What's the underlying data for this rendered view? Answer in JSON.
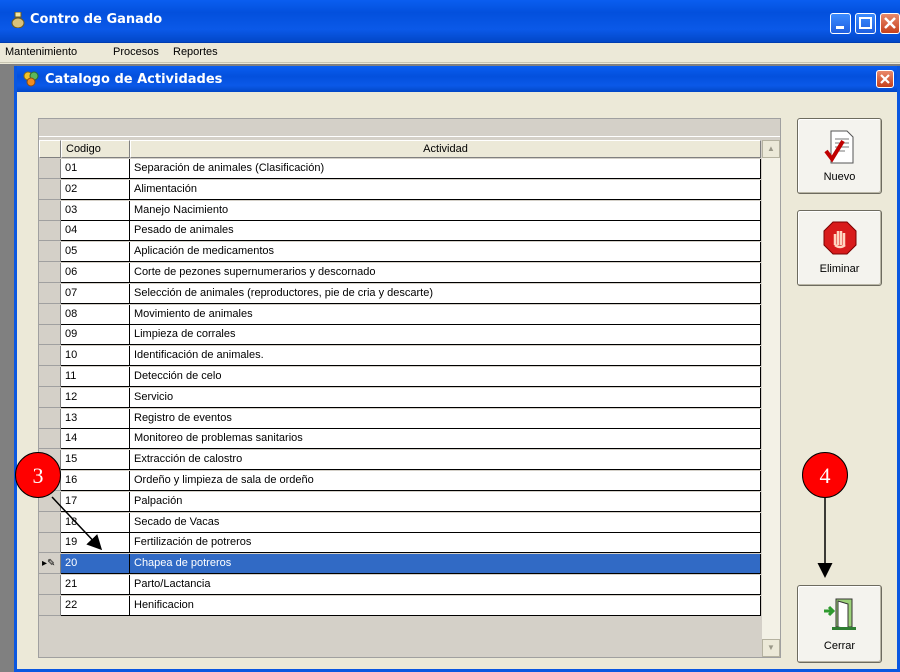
{
  "window": {
    "title": "Contro de Ganado"
  },
  "menu": [
    "Mantenimiento",
    "Procesos",
    "Reportes"
  ],
  "child_window": {
    "title": "Catalogo de Actividades"
  },
  "grid": {
    "headers": {
      "codigo": "Codigo",
      "actividad": "Actividad"
    },
    "rows": [
      {
        "codigo": "01",
        "actividad": "Separación de animales (Clasificación)"
      },
      {
        "codigo": "02",
        "actividad": "Alimentación"
      },
      {
        "codigo": "03",
        "actividad": "Manejo Nacimiento"
      },
      {
        "codigo": "04",
        "actividad": "Pesado de animales"
      },
      {
        "codigo": "05",
        "actividad": "Aplicación de medicamentos"
      },
      {
        "codigo": "06",
        "actividad": "Corte de pezones supernumerarios y descornado"
      },
      {
        "codigo": "07",
        "actividad": "Selección de animales (reproductores, pie de cria y descarte)"
      },
      {
        "codigo": "08",
        "actividad": "Movimiento de animales"
      },
      {
        "codigo": "09",
        "actividad": "Limpieza de corrales"
      },
      {
        "codigo": "10",
        "actividad": "Identificación de animales."
      },
      {
        "codigo": "11",
        "actividad": "Detección de celo"
      },
      {
        "codigo": "12",
        "actividad": "Servicio"
      },
      {
        "codigo": "13",
        "actividad": "Registro de eventos"
      },
      {
        "codigo": "14",
        "actividad": "Monitoreo de problemas sanitarios"
      },
      {
        "codigo": "15",
        "actividad": "Extracción de calostro"
      },
      {
        "codigo": "16",
        "actividad": "Ordeño y limpieza de sala de ordeño"
      },
      {
        "codigo": "17",
        "actividad": "Palpación"
      },
      {
        "codigo": "18",
        "actividad": "Secado de Vacas"
      },
      {
        "codigo": "19",
        "actividad": "Fertilización de potreros"
      },
      {
        "codigo": "20",
        "actividad": "Chapea de potreros",
        "selected": true
      },
      {
        "codigo": "21",
        "actividad": "Parto/Lactancia"
      },
      {
        "codigo": "22",
        "actividad": "Henificacion"
      }
    ]
  },
  "buttons": {
    "nuevo": "Nuevo",
    "eliminar": "Eliminar",
    "cerrar": "Cerrar"
  },
  "markers": {
    "m3": "3",
    "m4": "4"
  },
  "colors": {
    "selection": "#316ac5",
    "marker": "#ff0000",
    "titlebar": "#0a5ef0"
  }
}
